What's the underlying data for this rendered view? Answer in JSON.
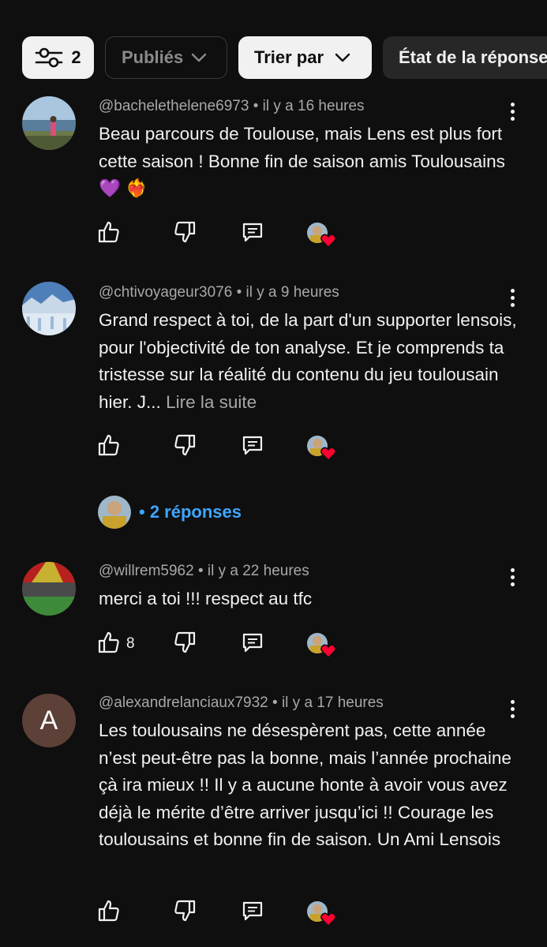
{
  "filters": {
    "filter_count": "2",
    "published_label": "Publiés",
    "sort_label": "Trier par",
    "response_state_label": "État de la réponse"
  },
  "comments": [
    {
      "author": "@bachelethelene6973",
      "time": "il y a 16 heures",
      "text": "Beau parcours de Toulouse, mais Lens est plus fort cette saison ! Bonne fin de saison amis Toulousains 💜 ❤️‍🔥",
      "likes": ""
    },
    {
      "author": "@chtivoyageur3076",
      "time": "il y a 9 heures",
      "text": "Grand respect à toi, de la part d'un supporter lensois, pour l'objectivité de ton analyse. Et je comprends ta tristesse sur la réalité du contenu du jeu toulousain hier. J...",
      "read_more": "Lire la suite",
      "likes": "",
      "replies_label": "2 réponses"
    },
    {
      "author": "@willrem5962",
      "time": "il y a 22 heures",
      "text": "merci a toi !!! respect au tfc",
      "likes": "8"
    },
    {
      "author": "@alexandrelanciaux7932",
      "time": "il y a 17 heures",
      "avatar_letter": "A",
      "text": "Les toulousains ne désespèrent pas, cette année n’est peut-être pas la bonne, mais l’année prochaine çà ira mieux !! Il y a aucune honte à avoir vous avez déjà le mérite d’être arriver jusqu’ici !! Courage les toulousains et bonne fin de saison.  Un Ami Lensois",
      "likes": ""
    }
  ],
  "separator": " • "
}
